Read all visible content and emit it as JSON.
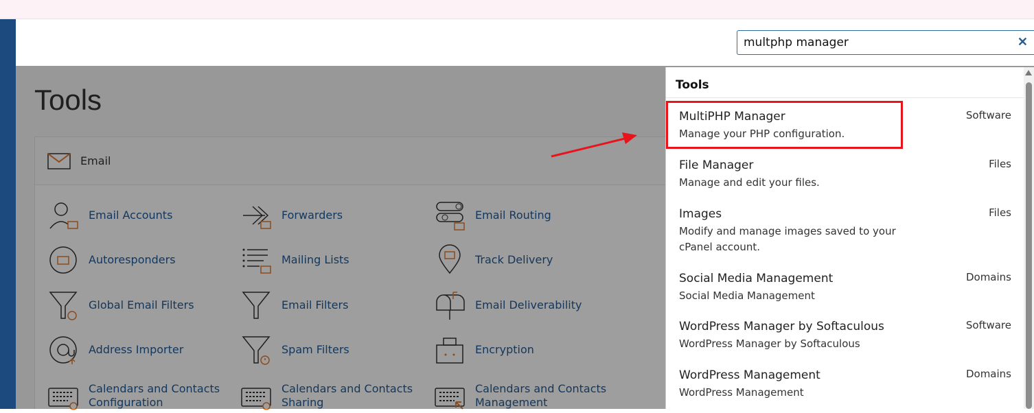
{
  "search": {
    "value": "multphp manager",
    "clear_icon": "close-icon"
  },
  "page": {
    "title": "Tools"
  },
  "email_section": {
    "label": "Email",
    "icon": "envelope-icon",
    "tools": [
      {
        "label": "Email Accounts",
        "icon": "user-mail-icon"
      },
      {
        "label": "Forwarders",
        "icon": "forward-arrow-icon"
      },
      {
        "label": "Email Routing",
        "icon": "routing-icon"
      },
      {
        "label": "Autoresponders",
        "icon": "autoresponder-icon"
      },
      {
        "label": "Mailing Lists",
        "icon": "list-mail-icon"
      },
      {
        "label": "Track Delivery",
        "icon": "map-pin-mail-icon"
      },
      {
        "label": "Global Email Filters",
        "icon": "funnel-globe-icon"
      },
      {
        "label": "Email Filters",
        "icon": "funnel-icon"
      },
      {
        "label": "Email Deliverability",
        "icon": "mailbox-icon"
      },
      {
        "label": "Address Importer",
        "icon": "at-sign-icon"
      },
      {
        "label": "Spam Filters",
        "icon": "funnel-warning-icon"
      },
      {
        "label": "Encryption",
        "icon": "lock-box-icon"
      },
      {
        "label": "Calendars and Contacts Configuration",
        "icon": "keyboard-at-icon"
      },
      {
        "label": "Calendars and Contacts Sharing",
        "icon": "keyboard-gear-icon"
      },
      {
        "label": "Calendars and Contacts Management",
        "icon": "keyboard-cursor-icon"
      }
    ]
  },
  "dropdown": {
    "heading": "Tools",
    "results": [
      {
        "name": "MultiPHP Manager",
        "desc": "Manage your PHP configuration.",
        "category": "Software"
      },
      {
        "name": "File Manager",
        "desc": "Manage and edit your files.",
        "category": "Files"
      },
      {
        "name": "Images",
        "desc": "Modify and manage images saved to your cPanel account.",
        "category": "Files"
      },
      {
        "name": "Social Media Management",
        "desc": "Social Media Management",
        "category": "Domains"
      },
      {
        "name": "WordPress Manager by Softaculous",
        "desc": "WordPress Manager by Softaculous",
        "category": "Software"
      },
      {
        "name": "WordPress Management",
        "desc": "WordPress Management",
        "category": "Domains"
      }
    ]
  },
  "annotation": {
    "highlight_color": "#e8141c"
  }
}
